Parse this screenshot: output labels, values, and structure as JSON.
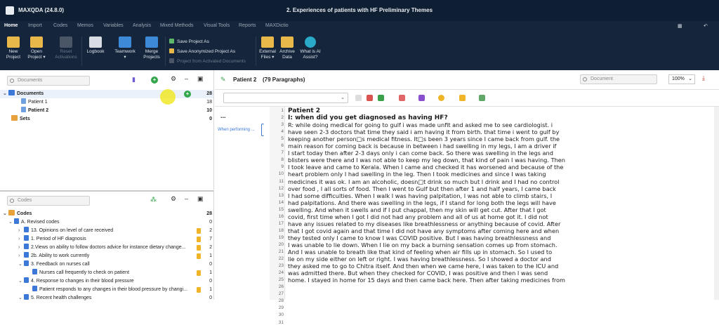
{
  "app": {
    "title": "MAXQDA (24.8.0)",
    "document_title": "2. Experiences of patients with HF Preliminary Themes"
  },
  "menu_tabs": [
    "Home",
    "Import",
    "Codes",
    "Memos",
    "Variables",
    "Analysis",
    "Mixed Methods",
    "Visual Tools",
    "Reports",
    "MAXDictio"
  ],
  "ribbon": {
    "new_project": [
      "New",
      "Project"
    ],
    "open_project": [
      "Open",
      "Project ▾"
    ],
    "reset_activations": [
      "Reset",
      "Activations"
    ],
    "logbook": "Logbook",
    "teamwork": [
      "Teamwork",
      "▾"
    ],
    "merge_projects": [
      "Merge",
      "Projects"
    ],
    "save_project": "Save Project As",
    "save_anonymized": "Save Anonymized Project As",
    "project_from_activated": "Project from Activated Documents",
    "external_files": [
      "External",
      "Files ▾"
    ],
    "archive_data": [
      "Archive",
      "Data"
    ],
    "ai_assist": [
      "What is AI",
      "Assist?"
    ]
  },
  "documents_panel": {
    "search_placeholder": "Documents",
    "rows": [
      {
        "label": "Documents",
        "count": "28"
      },
      {
        "label": "Patient 1",
        "count": "18"
      },
      {
        "label": "Patient 2",
        "count": "10"
      },
      {
        "label": "Sets",
        "count": "0"
      }
    ]
  },
  "codes_panel": {
    "search_placeholder": "Codes",
    "rows": [
      {
        "label": "Codes",
        "count": "28"
      },
      {
        "label": "A. Revised codes",
        "count": "0"
      },
      {
        "label": "13. Opinions on level of care received",
        "count": "2"
      },
      {
        "label": "1. Period of HF diagnosis",
        "count": "7"
      },
      {
        "label": "2.Views on ability to follow doctors advice for instance dietary change...",
        "count": "2"
      },
      {
        "label": "2b. Ability to work currently",
        "count": "1"
      },
      {
        "label": "3. Feedback on nurses call",
        "count": "0"
      },
      {
        "label": "Nurses call frequently to check on patient",
        "count": "1"
      },
      {
        "label": "4. Response to changes in their blood pressure",
        "count": "0"
      },
      {
        "label": "Patient responds to any changes in their blood pressure by changi...",
        "count": "1"
      },
      {
        "label": "5. Recent health challenges",
        "count": "0"
      }
    ]
  },
  "document_view": {
    "doc_name": "Patient 2",
    "paragraph_count": "(79 Paragraphs)",
    "search_placeholder": "Document",
    "zoom": "100%",
    "margin_dots": "...",
    "margin_code": "When performing ...",
    "line_numbers": [
      "1",
      "2",
      "3",
      "4",
      "5",
      "6",
      "7",
      "8",
      "9",
      "10",
      "11",
      "12",
      "13",
      "14",
      "15",
      "16",
      "17",
      "18",
      "19",
      "20",
      "21",
      "22",
      "23",
      "24",
      "25",
      "26",
      "27",
      "28",
      "29",
      "30",
      "31"
    ],
    "lines": [
      "Patient 2",
      "I: when did you get diagnosed as having HF?",
      "R: while doing medical for going to gulf i was made unfit and asked me to see cardiologist. i",
      "have seen 2-3 doctors that time they said i am having it from birth. that time i went to gulf by",
      "keeping another person□s medical fitness. It□s been 3 years since I came back from gulf. the",
      "main reason for coming back is because in between i had swelling in my legs, I am a driver if",
      "I start today then after 2-3 days only i can come back. So there was swelling in the legs and",
      "blisters were there and I was not able to keep my leg down, that kind of pain I was having. Then",
      "I took leave and came to Kerala. When I came and checked it has worsened and because of the",
      "heart problem only I had swelling in the leg. Then I took medicines and since I was taking",
      "medicines it was ok. I am an alcoholic, doesn□t drink so much but I drink and I had no control",
      "over food , I all sorts of food. Then I went to Gulf but then after 1 and half years, I came back",
      "I had some difficulties. When I walk I was having palpitation, I was not able to climb stairs, I",
      "had palpitations. And there was swelling in the legs, if I stand for long both the legs will have",
      "swelling. And when it swells and if I put chappal, then my skin will get cut. After that I got",
      "covid, first time when I got I did not had any problem and all of us at home got it. I did not",
      "have any issues related to my diseases like breathlessness or anything because of covid. After",
      "that I got covid again and that time I did not have any symptoms after coming here and when",
      "they tested only I came to know I was COVID positive. But I was having breathlessness and",
      "I was unable to lie down. When I lie on my back a burning sensation comes up from stomach.",
      "And I was unable to breath like that kind of feeling when air fills up in stomach. So I used to",
      "lie on my side either on left or right. I was having breathlessness. So I showed a doctor and",
      "they asked me to go to Chitra itself. And then when we came here, I was taken to the ICU and",
      "was admitted there. But when they checked for COVID, I was positive and then I was send",
      "home. I stayed in home for 15 days and then came back here. Then after taking medicines from"
    ]
  },
  "colors": {
    "titlebar": "#0f1f33",
    "ribbon": "#15263c",
    "accent_green": "#31a64a",
    "memo_yellow": "#f0b429",
    "cursor_highlight": "#f0e828"
  }
}
